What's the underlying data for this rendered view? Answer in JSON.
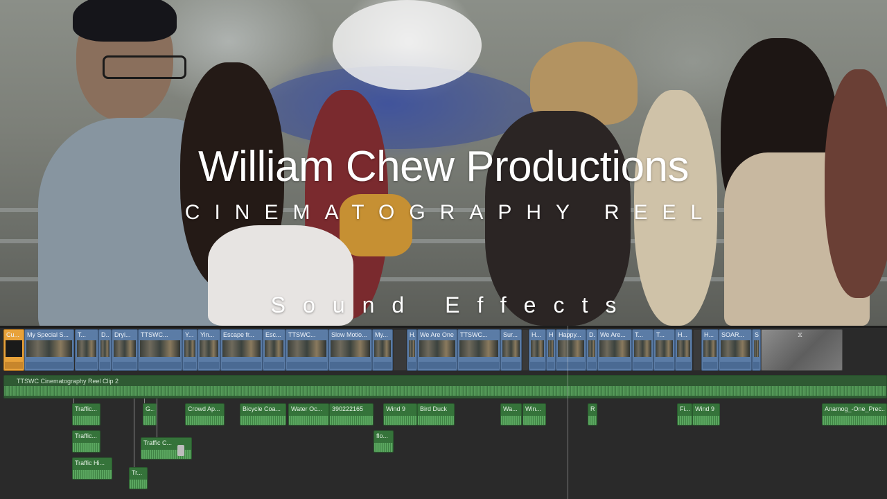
{
  "viewer": {
    "title": "William Chew Productions",
    "subtitle": "CINEMATOGRAPHY REEL",
    "caption": "Sound Effects"
  },
  "timeline": {
    "primary_clips": [
      {
        "label": "Cu...",
        "selected": true
      },
      {
        "label": "My Special S..."
      },
      {
        "label": "T..."
      },
      {
        "label": "D..."
      },
      {
        "label": "Dryi..."
      },
      {
        "label": "TTSWC..."
      },
      {
        "label": "Y..."
      },
      {
        "label": "Yin..."
      },
      {
        "label": "Escape fr..."
      },
      {
        "label": "Esc..."
      },
      {
        "label": "TTSWC..."
      },
      {
        "label": "Slow Motio..."
      },
      {
        "label": "My..."
      },
      {
        "label": "H..."
      },
      {
        "label": "We Are One"
      },
      {
        "label": "TTSWC..."
      },
      {
        "label": "Sur..."
      },
      {
        "label": "H..."
      },
      {
        "label": "H..."
      },
      {
        "label": "Happy..."
      },
      {
        "label": "D..."
      },
      {
        "label": "We Are..."
      },
      {
        "label": "T..."
      },
      {
        "label": "T..."
      },
      {
        "label": "H..."
      },
      {
        "label": "H..."
      },
      {
        "label": "SOAR..."
      },
      {
        "label": "S..."
      }
    ],
    "music_clip": {
      "label": "TTSWC Cinematography Reel Clip 2"
    },
    "sfx_clips": [
      {
        "label": "Traffic..."
      },
      {
        "label": "Traffic..."
      },
      {
        "label": "Traffic Hi..."
      },
      {
        "label": "Tr..."
      },
      {
        "label": "G..."
      },
      {
        "label": "Traffic C..."
      },
      {
        "label": "Crowd Ap..."
      },
      {
        "label": "Bicycle Coa..."
      },
      {
        "label": "Water Oc..."
      },
      {
        "label": "390222165"
      },
      {
        "label": "Wind 9"
      },
      {
        "label": "Bird Duck"
      },
      {
        "label": "flo..."
      },
      {
        "label": "Wa..."
      },
      {
        "label": "Win..."
      },
      {
        "label": "R..."
      },
      {
        "label": "Fi..."
      },
      {
        "label": "Wind 9"
      },
      {
        "label": "Anamog_-One_Prec..."
      }
    ]
  },
  "colors": {
    "primary_clip": "#5b7ca6",
    "selected_clip": "#e8a23a",
    "audio_clip": "#35733a",
    "music_clip": "#2f5a33",
    "timeline_bg": "#2a2a2a"
  }
}
